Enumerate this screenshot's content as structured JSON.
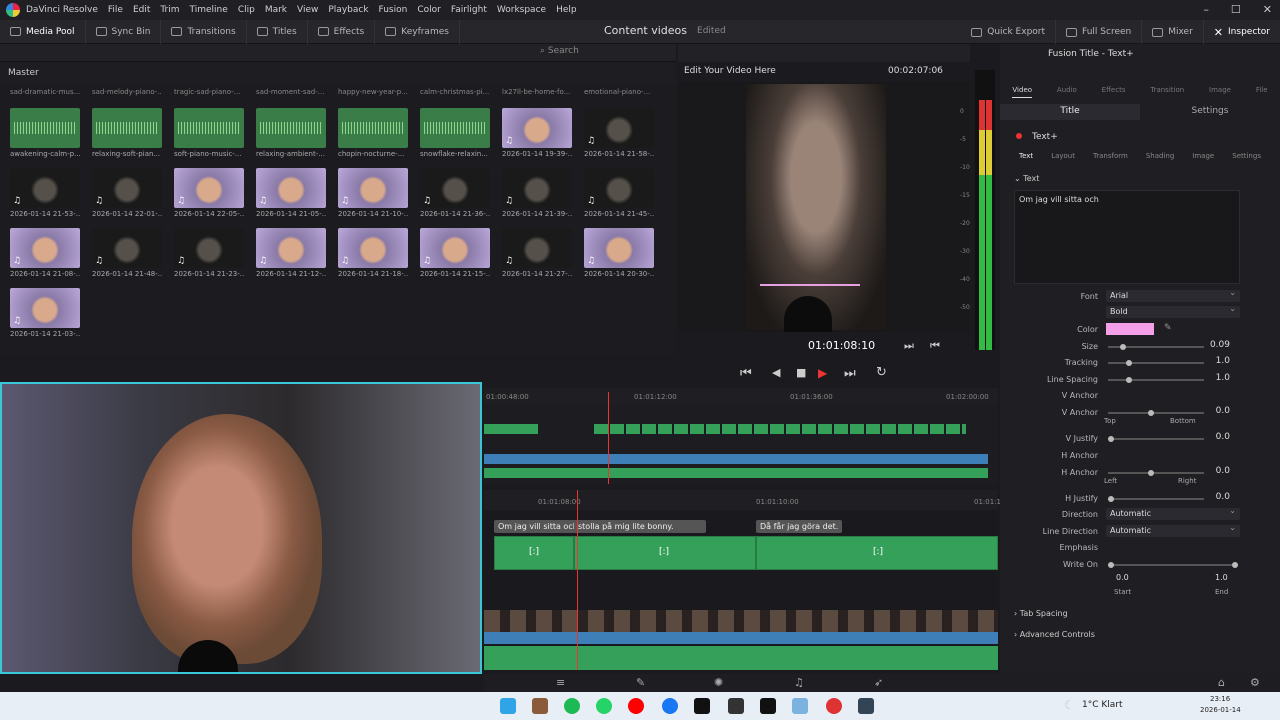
{
  "app": {
    "title": "DaVinci Resolve",
    "menu": [
      "File",
      "Edit",
      "Trim",
      "Timeline",
      "Clip",
      "Mark",
      "View",
      "Playback",
      "Fusion",
      "Color",
      "Fairlight",
      "Workspace",
      "Help"
    ]
  },
  "toolbar": {
    "media_pool": "Media Pool",
    "sync_bin": "Sync Bin",
    "transitions": "Transitions",
    "titles": "Titles",
    "effects": "Effects",
    "keyframes": "Keyframes",
    "project_name": "Content videos",
    "project_status": "Edited",
    "quick_export": "Quick Export",
    "full_screen": "Full Screen",
    "mixer": "Mixer",
    "inspector": "Inspector"
  },
  "media": {
    "search_placeholder": "Search",
    "bin": "Master",
    "top_labels": [
      "sad-dramatic-mus...",
      "sad-melody-piano-...",
      "tragic-sad-piano-...",
      "sad-moment-sad-...",
      "happy-new-year-p...",
      "calm-christmas-pi...",
      "lx27ll-be-home-fo...",
      "emotional-piano-..."
    ],
    "rows": [
      [
        "awakening-calm-p...",
        "relaxing-soft-pian...",
        "soft-piano-music-...",
        "relaxing-ambient-...",
        "chopin-nocturne-...",
        "snowflake-relaxin...",
        "2026-01-14 19-39-...",
        "2026-01-14 21-58-..."
      ],
      [
        "2026-01-14 21-53-...",
        "2026-01-14 22-01-...",
        "2026-01-14 22-05-...",
        "2026-01-14 21-05-...",
        "2026-01-14 21-10-...",
        "2026-01-14 21-36-...",
        "2026-01-14 21-39-...",
        "2026-01-14 21-45-..."
      ],
      [
        "2026-01-14 21-08-...",
        "2026-01-14 21-48-...",
        "2026-01-14 21-23-...",
        "2026-01-14 21-12-...",
        "2026-01-14 21-18-...",
        "2026-01-14 21-15-...",
        "2026-01-14 21-27-...",
        "2026-01-14 20-30-..."
      ],
      [
        "2026-01-14 21-03-..."
      ]
    ]
  },
  "viewer": {
    "title": "Edit Your Video Here",
    "duration": "00:02:07:06",
    "timecode": "01:01:08:10",
    "meter_ticks": [
      "0",
      "-5",
      "-10",
      "-15",
      "-20",
      "-30",
      "-40",
      "-50"
    ]
  },
  "timeline": {
    "ruler_top": [
      "01:00:48:00",
      "01:01:12:00",
      "01:01:36:00",
      "01:02:00:00"
    ],
    "ruler_main": [
      "01:01:08:00",
      "01:01:10:00",
      "01:01:1"
    ],
    "subtitles": [
      "Om jag vill sitta och",
      "stolla på mig lite bonny.",
      "Då får jag göra det."
    ],
    "title_glyph": "[:]"
  },
  "inspector": {
    "header": "Fusion Title - Text+",
    "tabs": [
      "Video",
      "Audio",
      "Effects",
      "Transition",
      "Image",
      "File"
    ],
    "sub_tabs": [
      "Title",
      "Settings"
    ],
    "node": "Text+",
    "text_tabs": [
      "Text",
      "Layout",
      "Transform",
      "Shading",
      "Image",
      "Settings"
    ],
    "section": "Text",
    "text_value": "Om jag vill sitta och",
    "font_label": "Font",
    "font": "Arial",
    "style": "Bold",
    "color_label": "Color",
    "color": "#f4a0e8",
    "size_label": "Size",
    "size": "0.09",
    "tracking_label": "Tracking",
    "tracking": "1.0",
    "line_spacing_label": "Line Spacing",
    "line_spacing": "1.0",
    "v_anchor_label": "V Anchor",
    "v_anchor": "0.0",
    "top": "Top",
    "bottom": "Bottom",
    "v_justify_label": "V Justify",
    "v_justify": "0.0",
    "h_anchor_label": "H Anchor",
    "h_anchor": "0.0",
    "left": "Left",
    "right": "Right",
    "h_justify_label": "H Justify",
    "h_justify": "0.0",
    "direction_label": "Direction",
    "direction": "Automatic",
    "line_direction_label": "Line Direction",
    "line_direction": "Automatic",
    "emphasis_label": "Emphasis",
    "write_on_label": "Write On",
    "write_start": "0.0",
    "write_end": "1.0",
    "start": "Start",
    "end": "End",
    "tab_spacing": "Tab Spacing",
    "advanced": "Advanced Controls"
  },
  "taskbar": {
    "weather": "1°C Klart",
    "time": "23:16",
    "date": "2026-01-14"
  }
}
